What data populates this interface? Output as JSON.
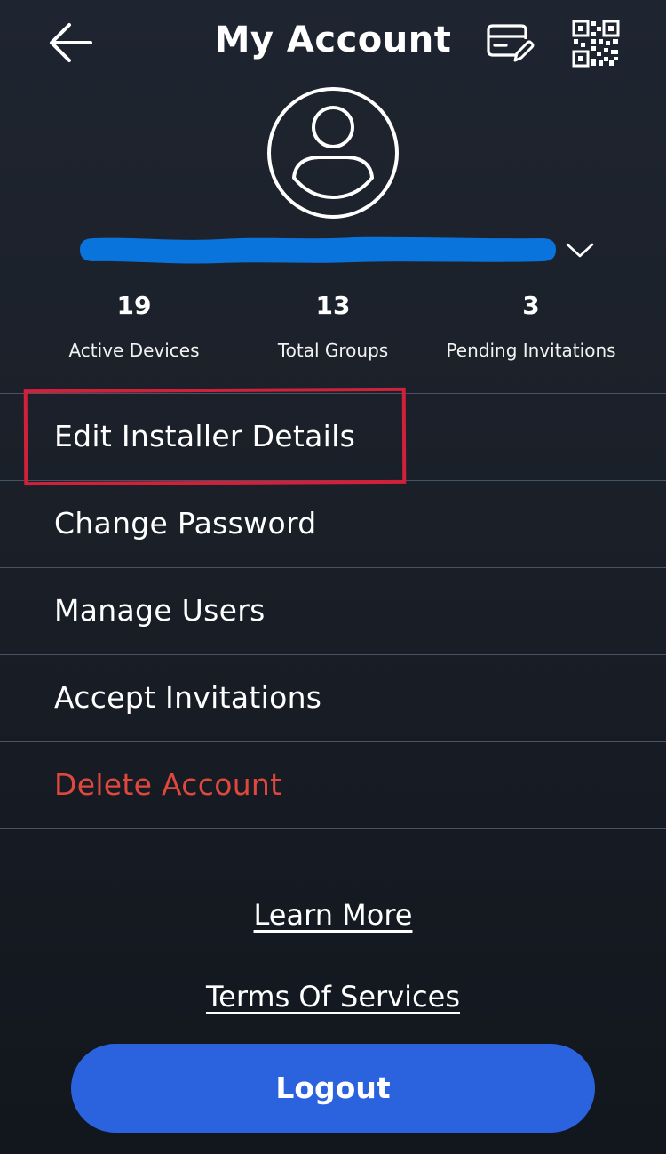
{
  "header": {
    "title": "My Account",
    "back_icon": "arrow-left-icon",
    "card_icon": "card-edit-icon",
    "qr_icon": "qr-code-icon"
  },
  "profile": {
    "avatar_icon": "user-avatar-icon",
    "name_redacted": true,
    "dropdown_icon": "chevron-down-icon"
  },
  "stats": [
    {
      "value": "19",
      "label": "Active Devices"
    },
    {
      "value": "13",
      "label": "Total Groups"
    },
    {
      "value": "3",
      "label": "Pending Invitations"
    }
  ],
  "menu": [
    {
      "label": "Edit Installer Details"
    },
    {
      "label": "Change Password"
    },
    {
      "label": "Manage Users"
    },
    {
      "label": "Accept Invitations"
    },
    {
      "label": "Delete Account"
    }
  ],
  "links": {
    "learn_more": "Learn More",
    "terms": "Terms Of Services"
  },
  "logout_label": "Logout",
  "colors": {
    "background": "#1c212b",
    "accent_blue": "#2b63df",
    "danger": "#e0483e",
    "highlight": "#d0203a",
    "redaction": "#0a74dd"
  }
}
